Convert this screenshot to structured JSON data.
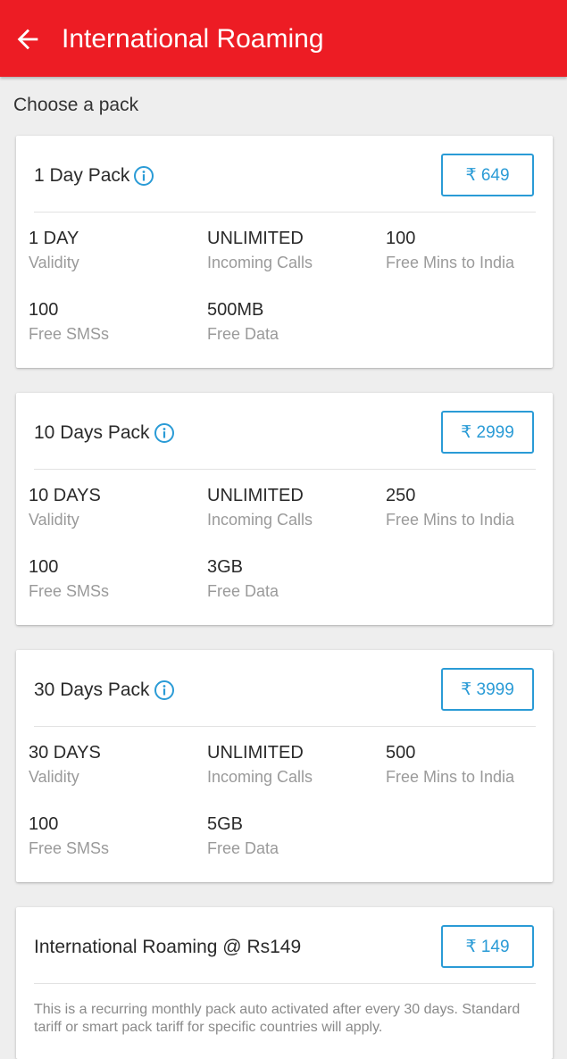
{
  "header": {
    "title": "International Roaming",
    "background": "#ed1c24"
  },
  "section_title": "Choose a pack",
  "accent_color": "#2a9bd6",
  "packs": [
    {
      "name": "1 Day Pack",
      "price": "₹ 649",
      "attributes": [
        {
          "value": "1 DAY",
          "label": "Validity"
        },
        {
          "value": "UNLIMITED",
          "label": "Incoming Calls"
        },
        {
          "value": "100",
          "label": "Free Mins to India"
        },
        {
          "value": "100",
          "label": "Free SMSs"
        },
        {
          "value": "500MB",
          "label": "Free Data"
        }
      ]
    },
    {
      "name": "10 Days Pack",
      "price": "₹ 2999",
      "attributes": [
        {
          "value": "10 DAYS",
          "label": "Validity"
        },
        {
          "value": "UNLIMITED",
          "label": "Incoming Calls"
        },
        {
          "value": "250",
          "label": "Free Mins to India"
        },
        {
          "value": "100",
          "label": "Free SMSs"
        },
        {
          "value": "3GB",
          "label": "Free Data"
        }
      ]
    },
    {
      "name": "30 Days Pack",
      "price": "₹ 3999",
      "attributes": [
        {
          "value": "30 DAYS",
          "label": "Validity"
        },
        {
          "value": "UNLIMITED",
          "label": "Incoming Calls"
        },
        {
          "value": "500",
          "label": "Free Mins to India"
        },
        {
          "value": "100",
          "label": "Free SMSs"
        },
        {
          "value": "5GB",
          "label": "Free Data"
        }
      ]
    }
  ],
  "recurring_pack": {
    "name": "International Roaming @ Rs149",
    "price": "₹ 149",
    "description": "This is a recurring monthly pack auto activated after every 30 days. Standard tariff or smart pack tariff for specific countries will apply."
  }
}
